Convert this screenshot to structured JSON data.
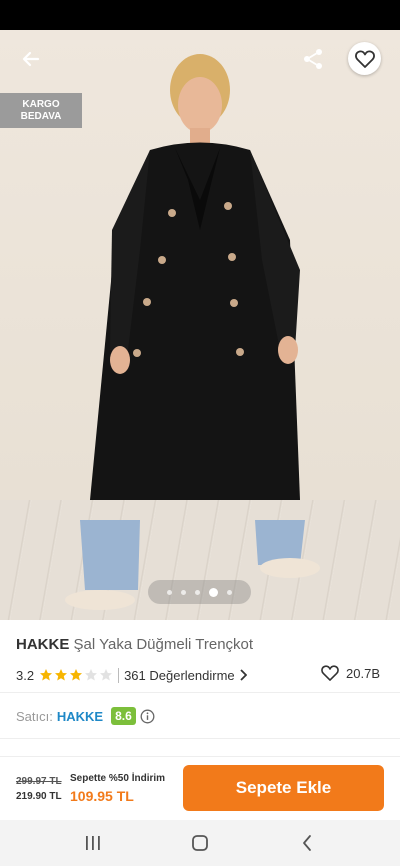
{
  "hero": {
    "badge_line1": "KARGO",
    "badge_line2": "BEDAVA",
    "slide_count": 5,
    "active_slide": 3
  },
  "product": {
    "brand": "HAKKE",
    "name": "Şal Yaka Düğmeli Trençkot",
    "rating": "3.2",
    "stars_filled": 3,
    "stars_total": 5,
    "reviews": "361 Değerlendirme",
    "likes": "20.7B"
  },
  "seller": {
    "label": "Satıcı:",
    "name": "HAKKE",
    "score": "8.6"
  },
  "price": {
    "old": "299.97 TL",
    "current": "219.90 TL",
    "promo": "Sepette %50 İndirim",
    "final": "109.95 TL",
    "add_to_cart": "Sepete Ekle"
  },
  "colors": {
    "accent": "#f27a1a",
    "seller_link": "#1e88c7",
    "score_badge": "#7cbf3b",
    "star": "#f7b500"
  },
  "icons": {
    "back": "back-arrow-icon",
    "share": "share-icon",
    "favorite": "heart-icon",
    "info": "info-icon",
    "chevron": "chevron-right-icon",
    "nav_recent": "recent-apps-icon",
    "nav_home": "home-icon",
    "nav_back": "back-icon"
  }
}
